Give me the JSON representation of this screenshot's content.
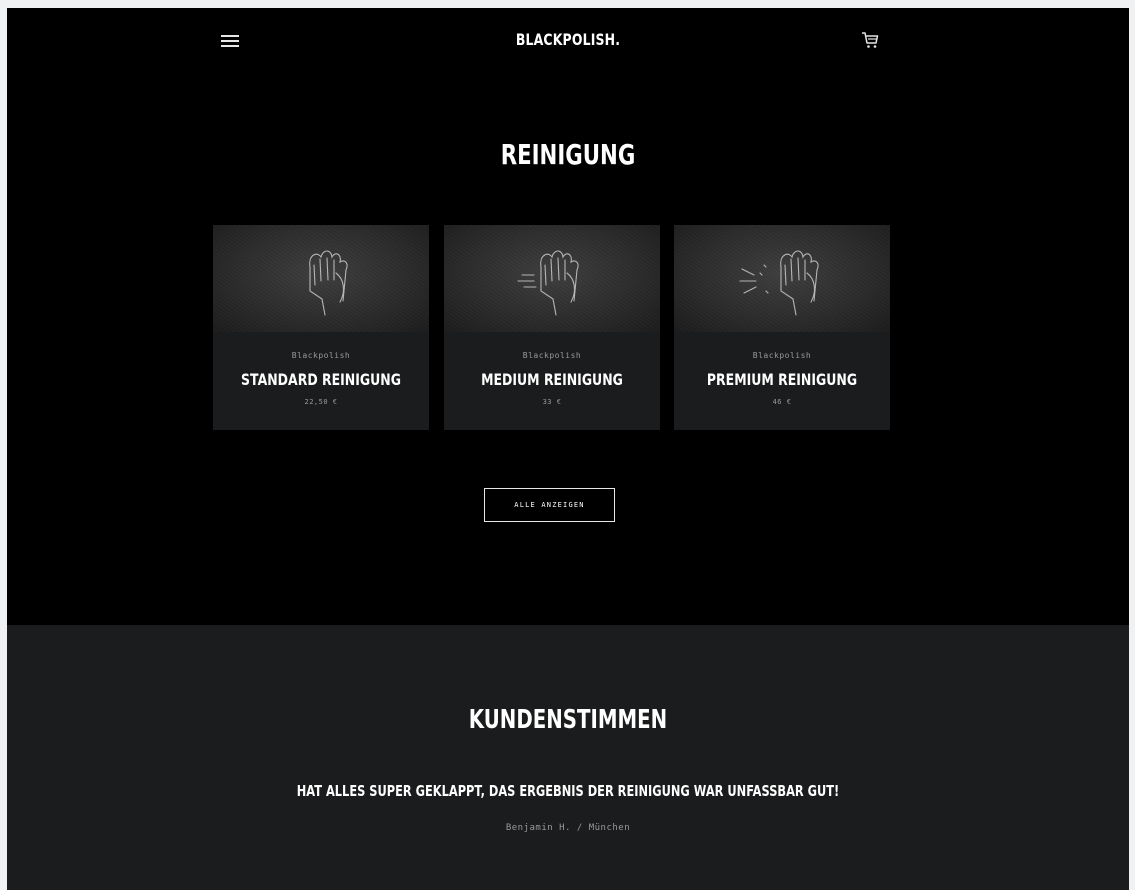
{
  "header": {
    "logo": "BLACKPOLISH.",
    "menu_icon": "hamburger-menu-icon",
    "cart_icon": "cart-icon"
  },
  "collection": {
    "title": "REINIGUNG",
    "products": [
      {
        "brand": "Blackpolish",
        "name": "STANDARD REINIGUNG",
        "price": "22,50 €",
        "image_icon": "polishing-hand-icon"
      },
      {
        "brand": "Blackpolish",
        "name": "MEDIUM REINIGUNG",
        "price": "33 €",
        "image_icon": "polishing-hand-motion-icon"
      },
      {
        "brand": "Blackpolish",
        "name": "PREMIUM REINIGUNG",
        "price": "46 €",
        "image_icon": "polishing-hand-sparkle-icon"
      }
    ],
    "view_all_label": "ALLE ANZEIGEN"
  },
  "testimonials": {
    "title": "KUNDENSTIMMEN",
    "quote": "HAT ALLES SUPER GEKLAPPT, DAS ERGEBNIS DER REINIGUNG WAR UNFASSBAR GUT!",
    "author": "Benjamin H. / München"
  },
  "colors": {
    "page_background": "#000000",
    "card_background": "#1b1c1d",
    "text_primary": "#ffffff",
    "text_muted": "#9a9a9a",
    "testimonial_background": "#1b1c1d"
  }
}
